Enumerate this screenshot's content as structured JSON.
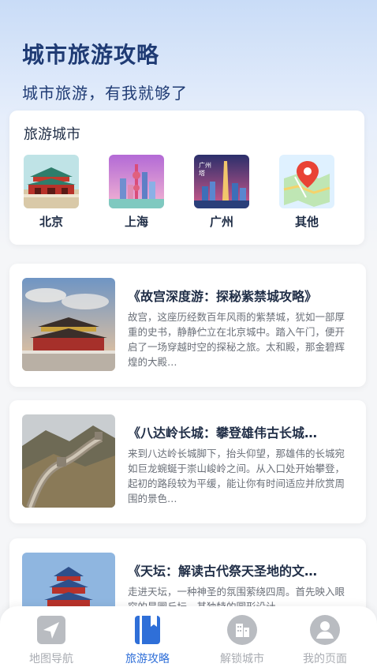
{
  "header": {
    "title": "城市旅游攻略",
    "subtitle": "城市旅游，有我就够了"
  },
  "cities": {
    "section_title": "旅游城市",
    "items": [
      {
        "name": "北京",
        "icon": "forbidden-city-thumbnail"
      },
      {
        "name": "上海",
        "icon": "shanghai-skyline-thumbnail"
      },
      {
        "name": "广州",
        "icon": "canton-tower-thumbnail"
      },
      {
        "name": "其他",
        "icon": "map-pin-icon"
      }
    ]
  },
  "articles": [
    {
      "title": "《故宫深度游：探秘紫禁城攻略》",
      "body": "故宫，这座历经数百年风雨的紫禁城，犹如一部厚重的史书，静静伫立在北京城中。踏入午门，便开启了一场穿越时空的探秘之旅。太和殿，那金碧辉煌的大殿…"
    },
    {
      "title": "《八达岭长城：攀登雄伟古长城…",
      "body": "来到八达岭长城脚下，抬头仰望，那雄伟的长城宛如巨龙蜿蜒于崇山峻岭之间。从入口处开始攀登，起初的路段较为平缓，能让你有时间适应并欣赏周围的景色…"
    },
    {
      "title": "《天坛：解读古代祭天圣地的文…",
      "body": "走进天坛，一种神圣的氛围萦绕四周。首先映入眼帘的是圜丘坛，其独特的圆形设计"
    }
  ],
  "tabbar": {
    "tabs": [
      {
        "label": "地图导航",
        "icon": "navigation-arrow-icon",
        "active": false
      },
      {
        "label": "旅游攻略",
        "icon": "guide-book-icon",
        "active": true
      },
      {
        "label": "解锁城市",
        "icon": "city-building-icon",
        "active": false
      },
      {
        "label": "我的页面",
        "icon": "user-icon",
        "active": false
      }
    ]
  },
  "colors": {
    "primary": "#2f6fd8",
    "title": "#1f3b74",
    "inactive": "#a9acb2"
  }
}
